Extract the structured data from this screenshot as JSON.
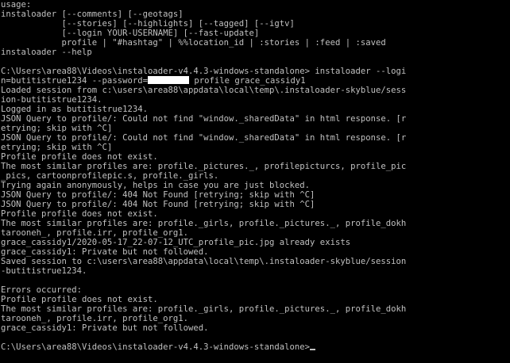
{
  "window": {
    "background": "#000000",
    "foreground": "#c0c0c0"
  },
  "lines": [
    "usage:",
    "instaloader [--comments] [--geotags]",
    "            [--stories] [--highlights] [--tagged] [--igtv]",
    "            [--login YOUR-USERNAME] [--fast-update]",
    "            profile | \"#hashtag\" | %%location_id | :stories | :feed | :saved",
    "instaloader --help",
    "",
    "C:\\Users\\area88\\Videos\\instaloader-v4.4.3-windows-standalone> instaloader --logi",
    "n=butitistrue1234 --password=",
    "Loaded session from c:\\users\\area88\\appdata\\local\\temp\\.instaloader-skyblue/sess",
    "ion-butitistrue1234.",
    "Logged in as butitistrue1234.",
    "JSON Query to profile/: Could not find \"window._sharedData\" in html response. [r",
    "etrying; skip with ^C]",
    "JSON Query to profile/: Could not find \"window._sharedData\" in html response. [r",
    "etrying; skip with ^C]",
    "Profile profile does not exist.",
    "The most similar profiles are: profile._pictures._, profilepicturcs, profile_pic",
    "_pics, cartoonprofilepic.s, profile._girls.",
    "Trying again anonymously, helps in case you are just blocked.",
    "JSON Query to profile/: 404 Not Found [retrying; skip with ^C]",
    "JSON Query to profile/: 404 Not Found [retrying; skip with ^C]",
    "Profile profile does not exist.",
    "The most similar profiles are: profile._girls, profile._pictures._, profile_dokh",
    "tarooneh_, profile.irr, profile_org1.",
    "grace_cassidy1/2020-05-17_22-07-12_UTC_profile_pic.jpg already exists",
    "grace_cassidy1: Private but not followed.",
    "Saved session to c:\\users\\area88\\appdata\\local\\temp\\.instaloader-skyblue/session",
    "-butitistrue1234.",
    "",
    "Errors occurred:",
    "Profile profile does not exist.",
    "The most similar profiles are: profile._girls, profile._pictures._, profile_dokh",
    "tarooneh_, profile.irr, profile_org1.",
    "grace_cassidy1: Private but not followed.",
    "",
    "C:\\Users\\area88\\Videos\\instaloader-v4.4.3-windows-standalone>"
  ],
  "redacted_line_suffix": " profile grace_cassidy1"
}
